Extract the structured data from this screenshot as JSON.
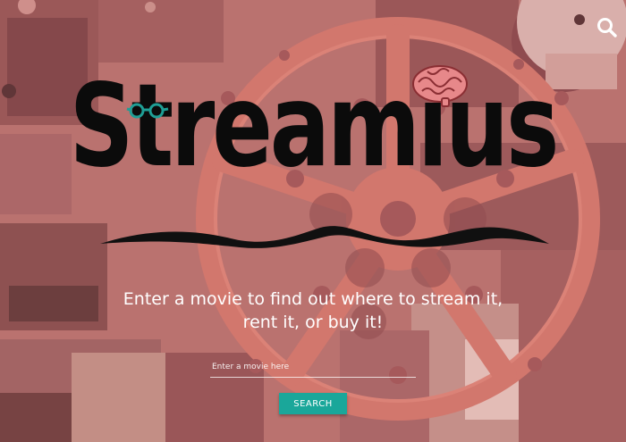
{
  "brand": {
    "name": "Streamius",
    "logo_ink": "#0b0b0b",
    "glasses_color": "#1f9e95",
    "brain_color": "#e7888a"
  },
  "header": {
    "search_icon": "search-icon"
  },
  "hero": {
    "tagline_line1": "Enter a movie to find out where to stream it,",
    "tagline_line2": "rent it, or buy it!",
    "background_tint": "#b86f6c"
  },
  "search": {
    "placeholder": "Enter a movie here",
    "value": "",
    "button_label": "SEARCH",
    "button_color": "#1aa79a"
  }
}
